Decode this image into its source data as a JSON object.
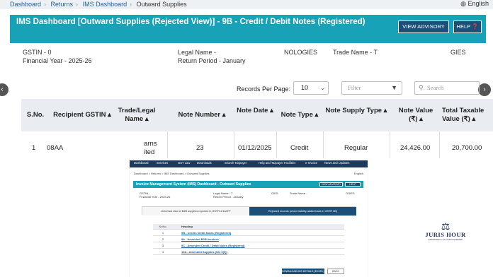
{
  "breadcrumb": [
    "Dashboard",
    "Returns",
    "IMS Dashboard",
    "Outward Supplies"
  ],
  "language": "English",
  "header": {
    "title": "IMS Dashboard [Outward Supplies (Rejected View)] - 9B - Credit / Debit Notes (Registered)",
    "advisory_label": "VIEW ADVISORY",
    "help_label": "HELP"
  },
  "info": {
    "gstin": "GSTIN - 0",
    "financial_year": "Financial Year - 2025-26",
    "legal_name": "Legal Name - ",
    "legal_name_tail": "NOLOGIES",
    "return_period": "Return Period - January",
    "trade_name": "Trade Name - T",
    "trade_name_tail": "GIES"
  },
  "controls": {
    "records_per_page_label": "Records Per Page:",
    "records_per_page_value": "10",
    "filter_placeholder": "Filter",
    "search_placeholder": "Search"
  },
  "table": {
    "columns": [
      "S.No.",
      "Recipient GSTIN",
      "Trade/Legal Name",
      "Note Number",
      "Note Date",
      "Note Type",
      "Note Supply Type",
      "Note Value (₹)",
      "Total Taxable Value (₹)"
    ],
    "rows": [
      {
        "sno": "1",
        "gstin": "08AA",
        "name_line1": "arns",
        "name_line2": "ited",
        "note_number": "23",
        "note_date": "01/12/2025",
        "note_type": "Credit",
        "supply_type": "Regular",
        "note_value": "24,426.00",
        "taxable_value": "20,700.00"
      }
    ]
  },
  "lower": {
    "nav": [
      "Dashboard",
      "Services",
      "GST Law",
      "Downloads",
      "Search Taxpayer",
      "Help and Taxpayer Facilities",
      "e-Invoice",
      "News and Updates"
    ],
    "crumb": "Dashboard > Returns > IMS Dashboard > Outward Supplies",
    "language": "English",
    "title": "Invoice Management System (IMS) Dashboard - Outward Supplies",
    "advisory_label": "VIEW ADVISORY",
    "help_label": "HELP",
    "gstin": "GSTIN -",
    "financial_year": "Financial Year - 2025-26",
    "legal_name": "Legal Name - T",
    "return_period": "Return Period - January",
    "legal_tail": "GIES",
    "trade_name": "Trade Name -",
    "trade_tail": "OGIES",
    "tab1": "Universal view of B2B supplies reported in GSTR-1/1A/IFF",
    "tab2": "Rejected records (where liability added back in GSTR 3B)",
    "table_head_sn": "Sr.No.",
    "table_head": "Heading",
    "rows": [
      {
        "sn": "1",
        "heading": "9B - Credit / Debit Notes (Registered)"
      },
      {
        "sn": "2",
        "heading": "9A - Amended B2B Invoices"
      },
      {
        "sn": "3",
        "heading": "9C - Amended Credit / Debit Notes (Registered)"
      },
      {
        "sn": "4",
        "heading": "15A - Amended Supplies (U/s 9(5))"
      }
    ],
    "download_label": "DOWNLOAD IMS DETAILS (EXCEL)",
    "back_label": "BACK"
  },
  "logo": {
    "title": "JURIS HOUR",
    "subtitle": "PROFICIENCY AT YOUR DOORSTEP"
  }
}
